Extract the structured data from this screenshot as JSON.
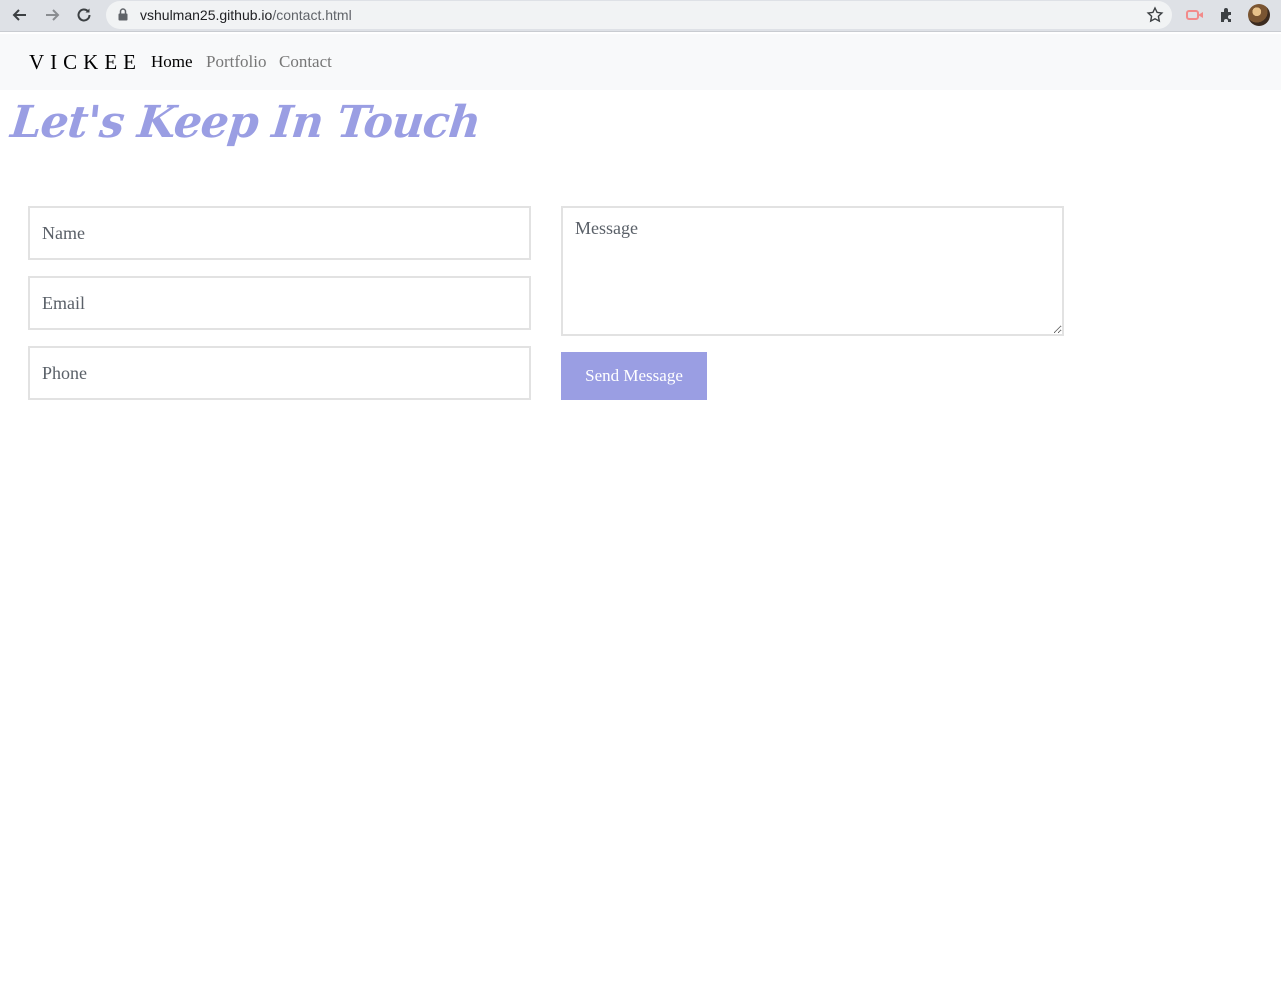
{
  "browser": {
    "url_host": "vshulman25.github.io",
    "url_path": "/contact.html",
    "icons": [
      "back-arrow-icon",
      "forward-arrow-icon",
      "reload-icon",
      "lock-icon",
      "star-icon",
      "extension-icon",
      "puzzle-icon",
      "avatar"
    ]
  },
  "nav": {
    "brand": "VICKEE",
    "links": [
      {
        "label": "Home",
        "active": true
      },
      {
        "label": "Portfolio",
        "active": false
      },
      {
        "label": "Contact",
        "active": false
      }
    ]
  },
  "page": {
    "title": "Let's Keep In Touch"
  },
  "form": {
    "name_placeholder": "Name",
    "email_placeholder": "Email",
    "phone_placeholder": "Phone",
    "message_placeholder": "Message",
    "send_label": "Send Message"
  },
  "colors": {
    "accent": "#9a9ee3",
    "navbar_bg": "#f8f9fa",
    "field_border": "#e2e2e2"
  }
}
